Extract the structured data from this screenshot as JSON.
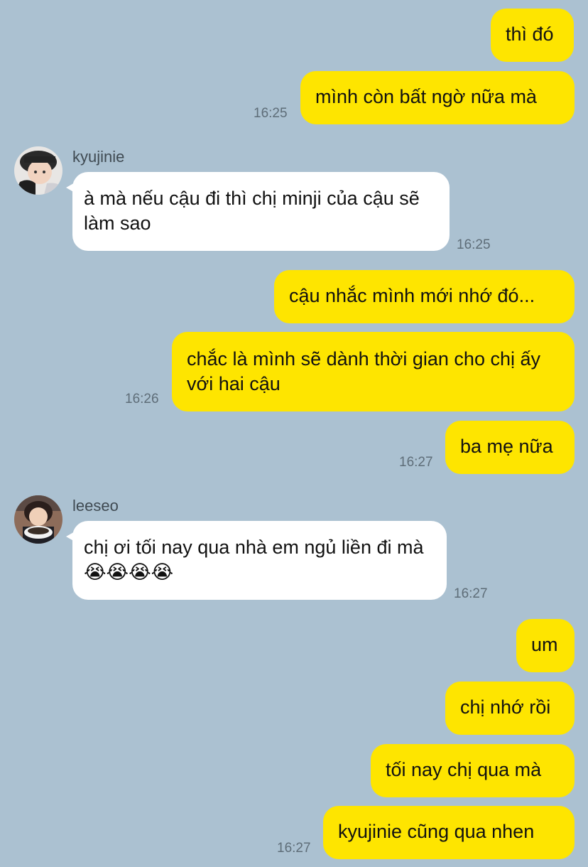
{
  "messages": {
    "m1": "thì đó",
    "m2": "mình còn bất ngờ nữa mà",
    "m2_time": "16:25",
    "k_name": "kyujinie",
    "k1": "à mà nếu cậu đi thì chị minji của cậu sẽ làm sao",
    "k1_time": "16:25",
    "m3": "cậu nhắc mình mới nhớ đó...",
    "m4": "chắc là mình sẽ dành thời gian cho chị ấy với hai cậu",
    "m4_time": "16:26",
    "m5": "ba mẹ nữa",
    "m5_time": "16:27",
    "l_name": "leeseo",
    "l1": "chị ơi tối nay qua nhà em ngủ liền đi mà 😭😭😭😭",
    "l1_time": "16:27",
    "m6": "um",
    "m7": "chị nhớ rồi",
    "m8": "tối nay chị qua mà",
    "m9": "kyujinie cũng qua nhen",
    "m9_time": "16:27"
  },
  "colors": {
    "background": "#abc1d1",
    "my_bubble": "#fee500",
    "their_bubble": "#ffffff"
  }
}
